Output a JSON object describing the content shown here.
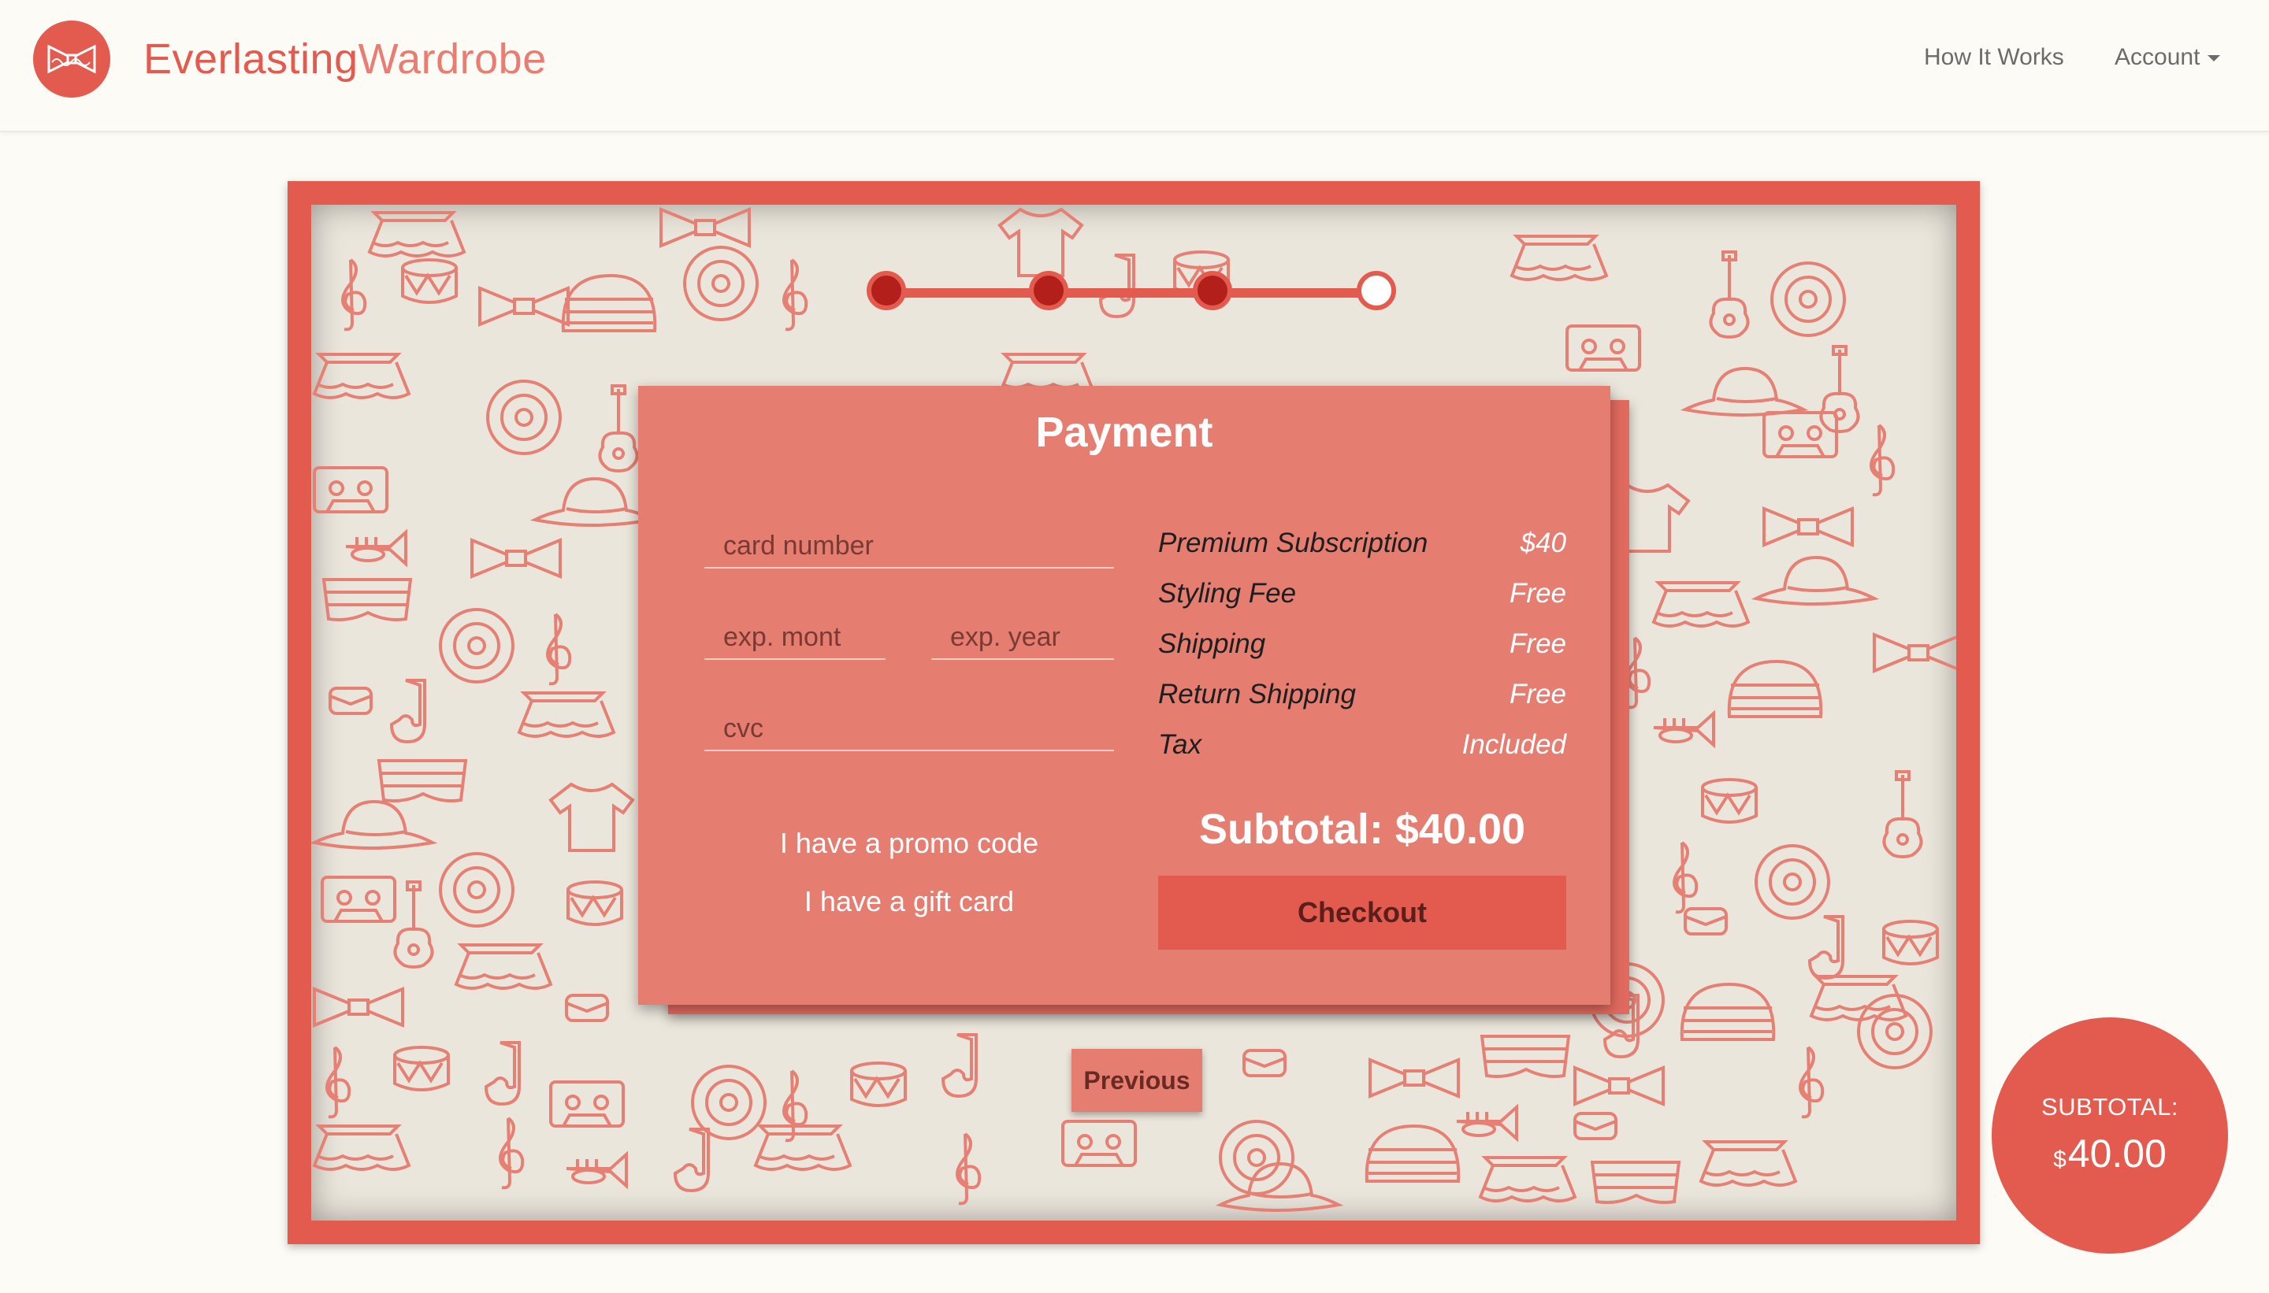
{
  "brand": {
    "part1": "Everlasting",
    "part2": "Wardrobe"
  },
  "nav": {
    "how_it_works": "How It Works",
    "account": "Account"
  },
  "stepper": {
    "total_steps": 4,
    "current_step": 4
  },
  "payment": {
    "title": "Payment",
    "card_number_placeholder": "card number",
    "exp_month_placeholder": "exp. mont",
    "exp_year_placeholder": "exp. year",
    "cvc_placeholder": "cvc",
    "promo_link": "I have a promo code",
    "gift_link": "I have a gift card",
    "summary": [
      {
        "label": "Premium Subscription",
        "value": "$40"
      },
      {
        "label": "Styling Fee",
        "value": "Free"
      },
      {
        "label": "Shipping",
        "value": "Free"
      },
      {
        "label": "Return Shipping",
        "value": "Free"
      },
      {
        "label": "Tax",
        "value": "Included"
      }
    ],
    "subtotal": "Subtotal: $40.00",
    "checkout_label": "Checkout"
  },
  "previous_label": "Previous",
  "bubble": {
    "label": "SUBTOTAL:",
    "currency": "$",
    "amount": "40.00"
  },
  "colors": {
    "accent": "#e35a4f",
    "card": "#e57d71",
    "background": "#fcfbf5",
    "board": "#ebe6dc"
  }
}
